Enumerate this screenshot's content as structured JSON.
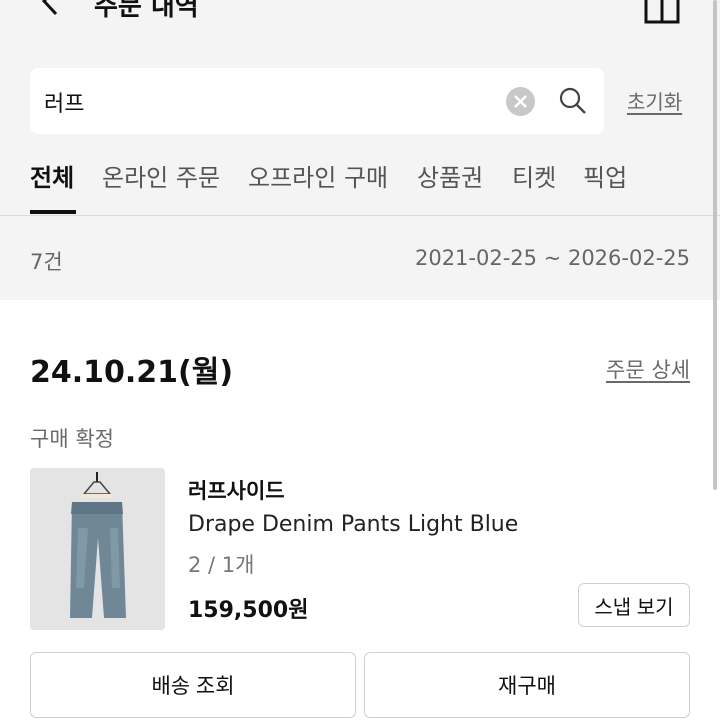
{
  "header": {
    "title": "주문 내역",
    "back_icon": "chevron-left-icon",
    "home_icon": "home-icon"
  },
  "search": {
    "value": "러프",
    "clear_icon": "clear-icon",
    "search_icon": "search-icon",
    "reset_label": "초기화"
  },
  "tabs": [
    {
      "label": "전체",
      "active": true
    },
    {
      "label": "온라인 주문",
      "active": false
    },
    {
      "label": "오프라인 구매",
      "active": false
    },
    {
      "label": "상품권",
      "active": false
    },
    {
      "label": "티켓",
      "active": false
    },
    {
      "label": "픽업",
      "active": false
    }
  ],
  "summary": {
    "count": "7건",
    "date_range": "2021-02-25 ~ 2026-02-25"
  },
  "order": {
    "date": "24.10.21(월)",
    "detail_link": "주문 상세",
    "status": "구매 확정",
    "item": {
      "brand": "러프사이드",
      "name": "Drape Denim Pants Light Blue",
      "option": "2 / 1개",
      "price": "159,500원",
      "snap_button": "스냅 보기"
    },
    "actions": {
      "delivery": "배송 조회",
      "reorder": "재구매"
    }
  },
  "colors": {
    "header_bg": "#f4f4f4",
    "text_primary": "#111111",
    "text_secondary": "#6a6a6a",
    "border": "#d0d0d0"
  }
}
